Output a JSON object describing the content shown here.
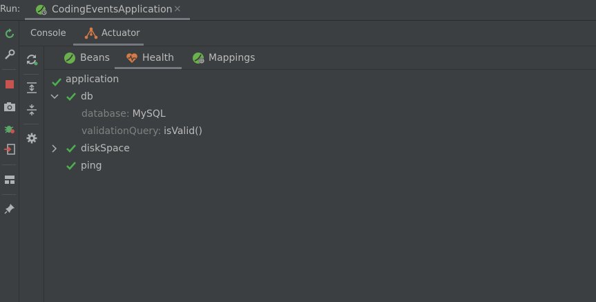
{
  "run_bar": {
    "label": "Run:",
    "tab_title": "CodingEventsApplication",
    "close_glyph": "×"
  },
  "left_toolbar": {
    "icons": [
      "rerun-icon",
      "wrench-icon",
      "stop-icon",
      "camera-icon",
      "debug-bug-icon",
      "exit-icon",
      "layout-icon",
      "pin-icon"
    ]
  },
  "tabs": {
    "console": "Console",
    "actuator": "Actuator"
  },
  "secondary_toolbar": {
    "icons": [
      "refresh-icon",
      "expand-all-icon",
      "collapse-all-icon",
      "settings-icon"
    ]
  },
  "bean_tabs": {
    "beans": "Beans",
    "health": "Health",
    "mappings": "Mappings",
    "selected": "Health"
  },
  "health_tree": {
    "application": "application",
    "db": "db",
    "database_key": "database:",
    "database_value": "MySQL",
    "validation_key": "validationQuery:",
    "validation_value": "isValid()",
    "disk_space": "diskSpace",
    "ping": "ping"
  },
  "colors": {
    "background": "#3c3f41",
    "status_ok_green": "#4caf50",
    "stop_red": "#c75450",
    "health_orange": "#d67a46",
    "spring_green": "#6ab04c"
  }
}
